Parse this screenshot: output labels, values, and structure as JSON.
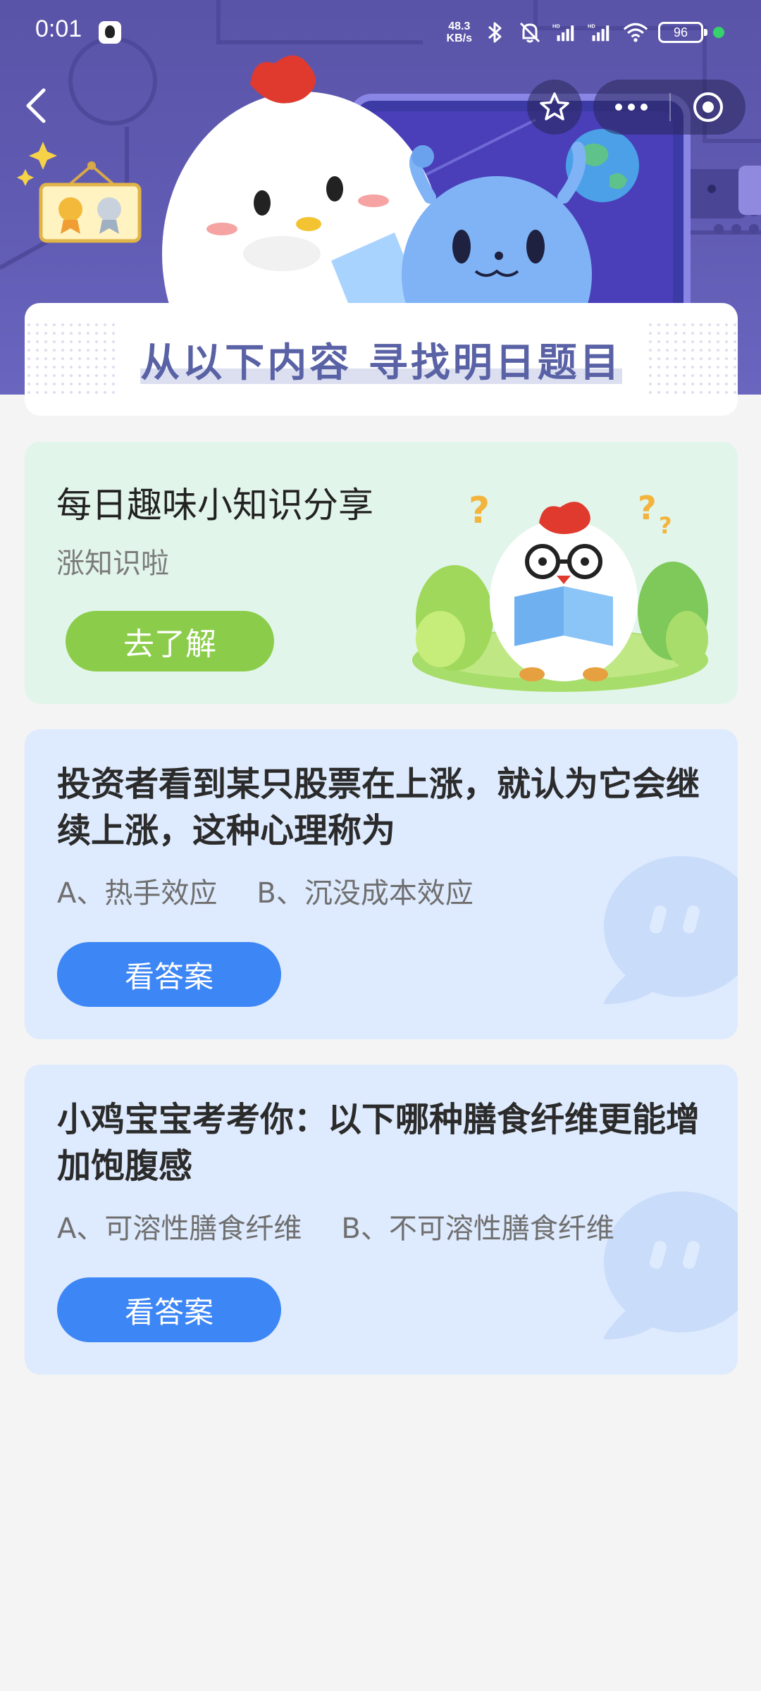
{
  "status_bar": {
    "time": "0:01",
    "net_speed_value": "48.3",
    "net_speed_unit": "KB/s",
    "battery": "96",
    "icons": [
      "qq-icon",
      "bluetooth-icon",
      "mute-bell-icon",
      "hd-signal-icon",
      "hd-signal-icon",
      "wifi-icon",
      "battery-icon"
    ]
  },
  "nav": {
    "back_icon": "chevron-left-icon",
    "favorite_icon": "star-icon",
    "more_icon": "more-dots-icon",
    "close_icon": "target-circle-icon"
  },
  "banner": {
    "title": "从以下内容 寻找明日题目"
  },
  "knowledge": {
    "title": "每日趣味小知识分享",
    "subtitle": "涨知识啦",
    "button": "去了解"
  },
  "questions": [
    {
      "title": "投资者看到某只股票在上涨，就认为它会继续上涨，这种心理称为",
      "option_a": "A、热手效应",
      "option_b": "B、沉没成本效应",
      "button": "看答案"
    },
    {
      "title": "小鸡宝宝考考你：以下哪种膳食纤维更能增加饱腹感",
      "option_a": "A、可溶性膳食纤维",
      "option_b": "B、不可溶性膳食纤维",
      "button": "看答案"
    }
  ],
  "colors": {
    "banner": "#5a54a8",
    "knowledge_card": "#e2f5ea",
    "knowledge_button": "#8bcd4a",
    "question_card": "#deeafd",
    "answer_button": "#3d86f5",
    "title_text": "#5a62a6"
  }
}
